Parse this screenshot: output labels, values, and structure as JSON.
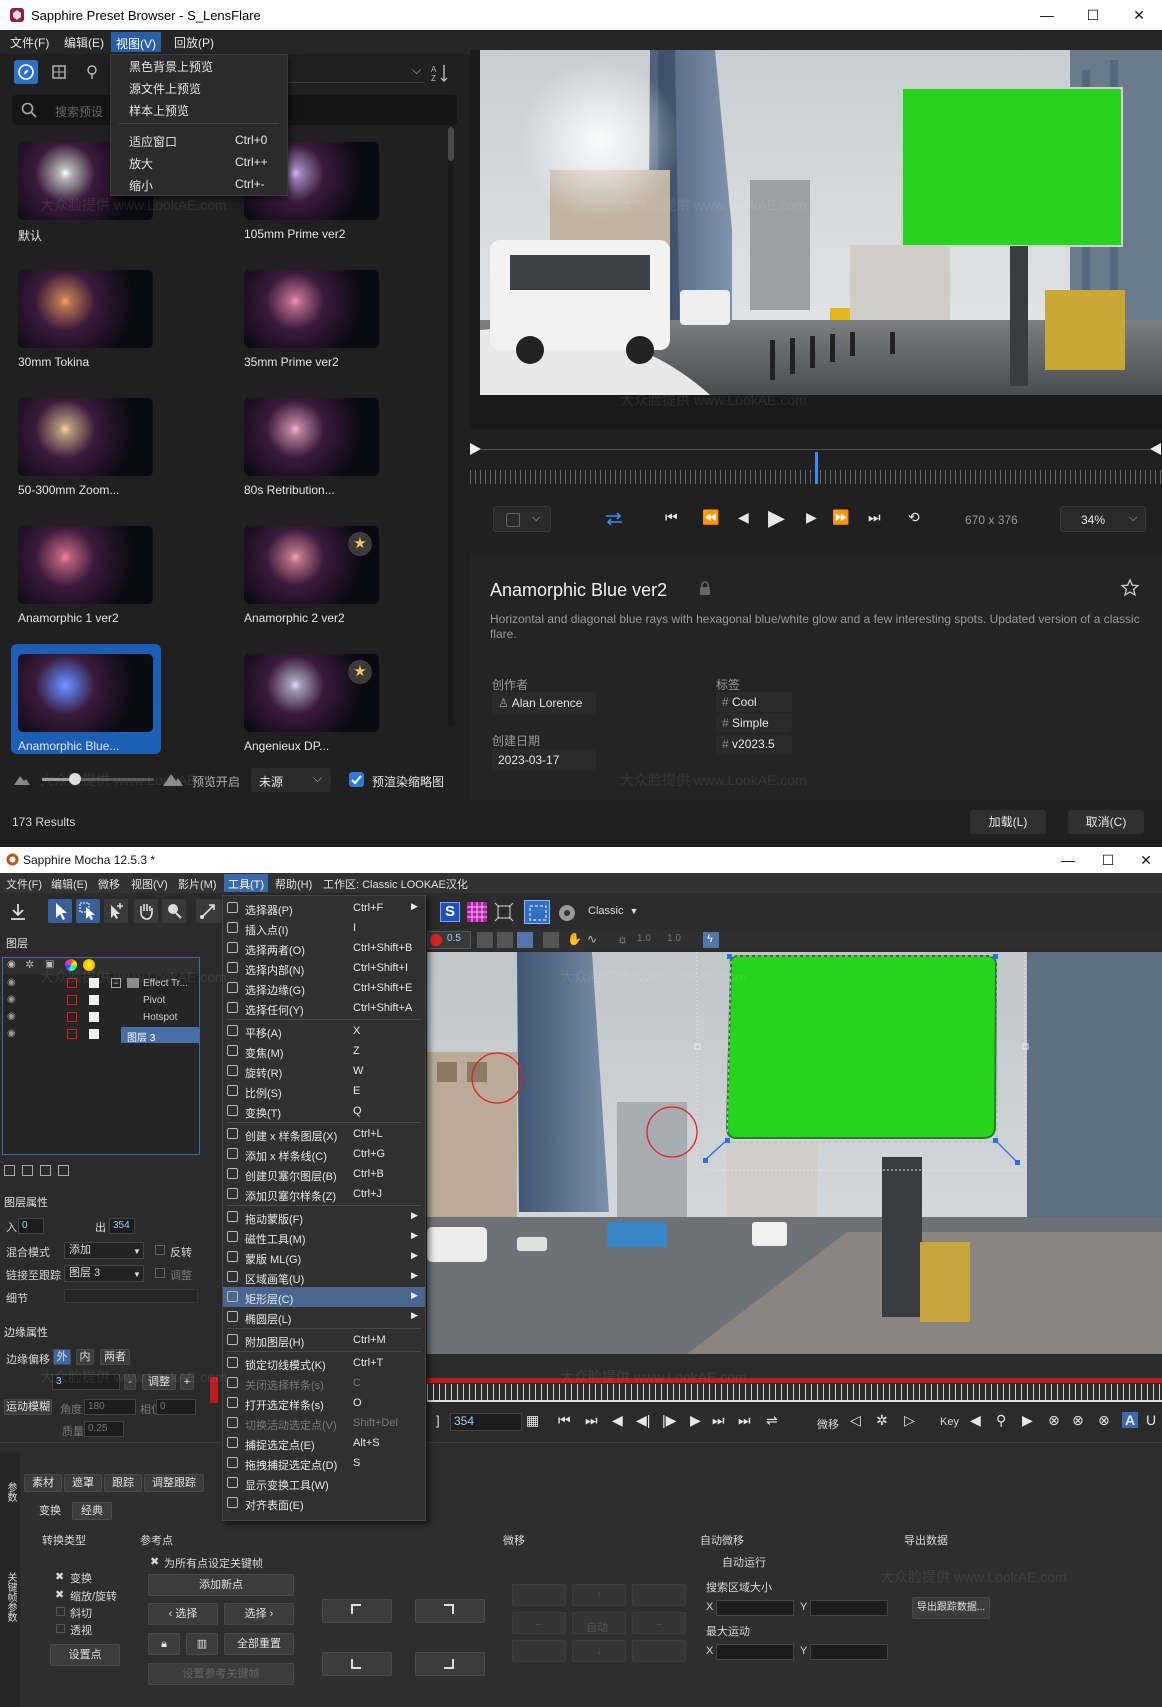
{
  "window1": {
    "title": "Sapphire Preset Browser - S_LensFlare",
    "controls": {
      "minimize": "—",
      "maximize": "☐",
      "close": "✕"
    },
    "menu": [
      "文件(F)",
      "编辑(E)",
      "视图(V)",
      "回放(P)"
    ],
    "search_placeholder": "搜索预设",
    "view_menu": {
      "items": [
        {
          "label": "黑色背景上预览",
          "shortcut": ""
        },
        {
          "label": "源文件上预览",
          "shortcut": ""
        },
        {
          "label": "样本上预览",
          "shortcut": ""
        },
        {
          "label": "适应窗口",
          "shortcut": "Ctrl+0"
        },
        {
          "label": "放大",
          "shortcut": "Ctrl++"
        },
        {
          "label": "缩小",
          "shortcut": "Ctrl+-"
        }
      ]
    },
    "presets": [
      {
        "name": "默认",
        "fav": false,
        "selected": false
      },
      {
        "name": "105mm Prime ver2",
        "fav": false,
        "selected": false
      },
      {
        "name": "30mm Tokina",
        "fav": false,
        "selected": false
      },
      {
        "name": "35mm Prime ver2",
        "fav": false,
        "selected": false
      },
      {
        "name": "50-300mm Zoom...",
        "fav": false,
        "selected": false
      },
      {
        "name": "80s Retribution...",
        "fav": false,
        "selected": false
      },
      {
        "name": "Anamorphic 1 ver2",
        "fav": false,
        "selected": false
      },
      {
        "name": "Anamorphic 2 ver2",
        "fav": true,
        "selected": false
      },
      {
        "name": "Anamorphic Blue...",
        "fav": false,
        "selected": true
      },
      {
        "name": "Angenieux DP...",
        "fav": true,
        "selected": false
      }
    ],
    "preview_open_label": "预览开启",
    "preview_source": "未源",
    "prerender_label": "预渲染缩略图",
    "results": "173 Results",
    "transport": {
      "resolution": "670 x 376",
      "zoom": "34%"
    },
    "info": {
      "title": "Anamorphic Blue ver2",
      "description": "Horizontal and diagonal blue rays with hexagonal blue/white glow and a few interesting spots. Updated version of a classic flare.",
      "author_label": "创作者",
      "author": "Alan Lorence",
      "date_label": "创建日期",
      "date": "2023-03-17",
      "tags_label": "标签",
      "tags": [
        "Cool",
        "Simple",
        "v2023.5"
      ]
    },
    "load_button": "加载(L)",
    "cancel_button": "取消(C)"
  },
  "window2": {
    "title": "Sapphire Mocha 12.5.3 *",
    "menu": [
      "文件(F)",
      "编辑(E)",
      "微移",
      "视图(V)",
      "影片(M)",
      "工具(T)",
      "帮助(H)",
      "工作区: Classic  LOOKAE汉化"
    ],
    "workspace_select": "Classic",
    "layers_title": "图层",
    "layers": [
      "Effect Tr...",
      "Pivot",
      "Hotspot",
      "图层 3"
    ],
    "layer_props_title": "图层属性",
    "in_label": "入",
    "in_value": "0",
    "out_label": "出",
    "out_value": "354",
    "blend_label": "混合模式",
    "blend_value": "添加",
    "invert_label": "反转",
    "link_label": "链接至跟踪",
    "link_value": "图层 3",
    "adjust_label": "调整",
    "detail_label": "细节",
    "edge_title": "边缘属性",
    "edge_offset_label": "边缘偏移",
    "edge_opts": [
      "外",
      "内",
      "两者"
    ],
    "edge_value": "3",
    "edge_adjust": "调整",
    "motion_blur": "运动模糊",
    "angle_label": "角度",
    "angle_value": "180",
    "phase_label": "相位",
    "phase_value": "0",
    "quality_label": "质量",
    "quality_value": "0.25",
    "tools_menu": [
      {
        "label": "选择器(P)",
        "shortcut": "Ctrl+F",
        "sub": true,
        "dim": false
      },
      {
        "label": "插入点(I)",
        "shortcut": "I",
        "sub": false,
        "dim": false
      },
      {
        "label": "选择两者(O)",
        "shortcut": "Ctrl+Shift+B",
        "sub": false,
        "dim": false
      },
      {
        "label": "选择内部(N)",
        "shortcut": "Ctrl+Shift+I",
        "sub": false,
        "dim": false
      },
      {
        "label": "选择边缘(G)",
        "shortcut": "Ctrl+Shift+E",
        "sub": false,
        "dim": false
      },
      {
        "label": "选择任何(Y)",
        "shortcut": "Ctrl+Shift+A",
        "sub": false,
        "dim": false
      },
      {
        "label": "平移(A)",
        "shortcut": "X",
        "sub": false,
        "dim": false
      },
      {
        "label": "变焦(M)",
        "shortcut": "Z",
        "sub": false,
        "dim": false
      },
      {
        "label": "旋转(R)",
        "shortcut": "W",
        "sub": false,
        "dim": false
      },
      {
        "label": "比例(S)",
        "shortcut": "E",
        "sub": false,
        "dim": false
      },
      {
        "label": "变换(T)",
        "shortcut": "Q",
        "sub": false,
        "dim": false
      },
      {
        "label": "创建 x 样条图层(X)",
        "shortcut": "Ctrl+L",
        "sub": false,
        "dim": false
      },
      {
        "label": "添加 x 样条线(C)",
        "shortcut": "Ctrl+G",
        "sub": false,
        "dim": false
      },
      {
        "label": "创建贝塞尔图层(B)",
        "shortcut": "Ctrl+B",
        "sub": false,
        "dim": false
      },
      {
        "label": "添加贝塞尔样条(Z)",
        "shortcut": "Ctrl+J",
        "sub": false,
        "dim": false
      },
      {
        "label": "拖动蒙版(F)",
        "shortcut": "",
        "sub": true,
        "dim": false
      },
      {
        "label": "磁性工具(M)",
        "shortcut": "",
        "sub": true,
        "dim": false
      },
      {
        "label": "蒙版 ML(G)",
        "shortcut": "",
        "sub": true,
        "dim": false
      },
      {
        "label": "区域画笔(U)",
        "shortcut": "",
        "sub": true,
        "dim": false
      },
      {
        "label": "矩形层(C)",
        "shortcut": "",
        "sub": true,
        "dim": false,
        "hl": true
      },
      {
        "label": "椭圆层(L)",
        "shortcut": "",
        "sub": true,
        "dim": false
      },
      {
        "label": "附加图层(H)",
        "shortcut": "Ctrl+M",
        "sub": false,
        "dim": false
      },
      {
        "label": "锁定切线模式(K)",
        "shortcut": "Ctrl+T",
        "sub": false,
        "dim": false
      },
      {
        "label": "关闭选择样条(s)",
        "shortcut": "C",
        "sub": false,
        "dim": true
      },
      {
        "label": "打开选定样条(s)",
        "shortcut": "O",
        "sub": false,
        "dim": false
      },
      {
        "label": "切换活动选定点(V)",
        "shortcut": "Shift+Del",
        "sub": false,
        "dim": true
      },
      {
        "label": "捕捉选定点(E)",
        "shortcut": "Alt+S",
        "sub": false,
        "dim": false
      },
      {
        "label": "拖拽捕捉选定点(D)",
        "shortcut": "S",
        "sub": false,
        "dim": false
      },
      {
        "label": "显示变换工具(W)",
        "shortcut": "",
        "sub": false,
        "dim": false
      },
      {
        "label": "对齐表面(E)",
        "shortcut": "",
        "sub": false,
        "dim": false
      }
    ],
    "frame": "354",
    "nudge_label": "微移",
    "key_label": "Key",
    "bottom_tabs": [
      "素材",
      "遮罩",
      "跟踪",
      "调整跟踪"
    ],
    "side_tab": "关键帧参数",
    "side_tab2": "参数",
    "sub_tabs": [
      "变换",
      "经典"
    ],
    "transform_type_label": "转换类型",
    "ref_point_label": "参考点",
    "nudge_section": "微移",
    "auto_nudge": "自动微移",
    "export_data": "导出数据",
    "checks": [
      "变换",
      "缩放/旋转",
      "斜切",
      "透视"
    ],
    "keyframe_all": "为所有点设定关键帧",
    "add_point": "添加新点",
    "sel_prev": "‹ 选择",
    "sel_next": "选择 ›",
    "set_point": "设置点",
    "reset_all": "全部重置",
    "set_ref_key": "设置参考关键帧",
    "auto_run": "自动运行",
    "search_area": "搜索区域大小",
    "max_motion": "最大运动",
    "x_label": "X",
    "y_label": "Y",
    "auto_btn": "自动",
    "export_tracking": "导出跟踪数据..."
  },
  "watermark": "大众脸提供 www.LookAE.com"
}
